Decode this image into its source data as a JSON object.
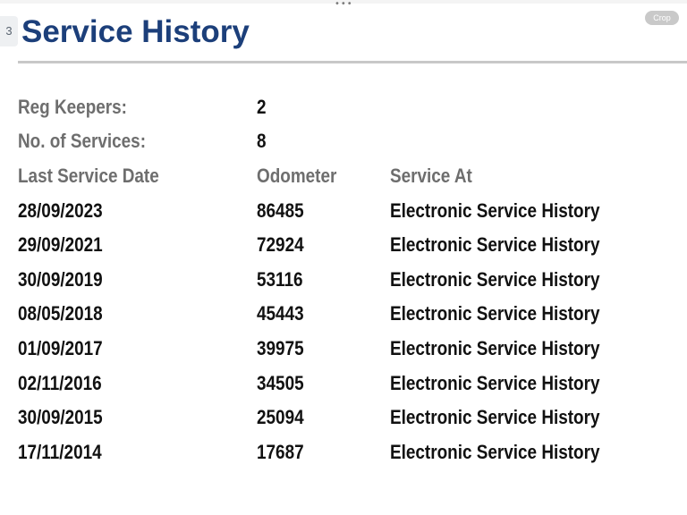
{
  "viewer": {
    "page_number": "3",
    "crop_label": "Crop",
    "more_label": "•••"
  },
  "header": {
    "title": "Service History"
  },
  "summary": [
    {
      "label": "Reg Keepers:",
      "value": "2"
    },
    {
      "label": "No. of Services:",
      "value": "8"
    }
  ],
  "table": {
    "columns": [
      "Last Service Date",
      "Odometer",
      "Service At"
    ],
    "rows": [
      {
        "date": "28/09/2023",
        "odometer": "86485",
        "service_at": "Electronic Service History"
      },
      {
        "date": "29/09/2021",
        "odometer": "72924",
        "service_at": "Electronic Service History"
      },
      {
        "date": "30/09/2019",
        "odometer": "53116",
        "service_at": "Electronic Service History"
      },
      {
        "date": "08/05/2018",
        "odometer": "45443",
        "service_at": "Electronic Service History"
      },
      {
        "date": "01/09/2017",
        "odometer": "39975",
        "service_at": "Electronic Service History"
      },
      {
        "date": "02/11/2016",
        "odometer": "34505",
        "service_at": "Electronic Service History"
      },
      {
        "date": "30/09/2015",
        "odometer": "25094",
        "service_at": "Electronic Service History"
      },
      {
        "date": "17/11/2014",
        "odometer": "17687",
        "service_at": "Electronic Service History"
      }
    ]
  },
  "colors": {
    "title": "#1c3f7a",
    "label": "#6e6e6e",
    "value": "#111111",
    "rule": "#c8c8c8"
  }
}
